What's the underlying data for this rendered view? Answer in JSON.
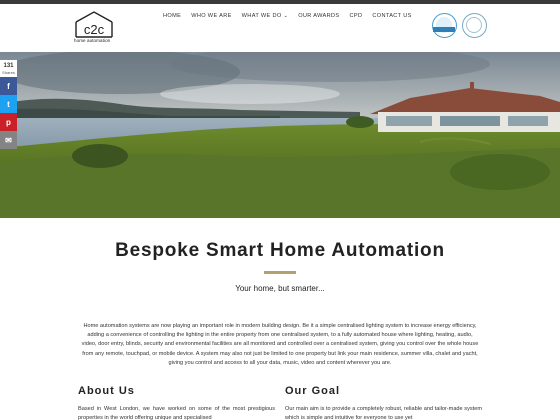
{
  "logo": {
    "mark": "c2c",
    "tagline": "home automation"
  },
  "nav": {
    "items": [
      {
        "label": "HOME"
      },
      {
        "label": "WHO WE ARE"
      },
      {
        "label": "WHAT WE DO",
        "has_dropdown": true
      },
      {
        "label": "OUR AWARDS"
      },
      {
        "label": "CPD"
      },
      {
        "label": "CONTACT US"
      }
    ]
  },
  "badges": [
    {
      "icon": "award-badge-icon"
    },
    {
      "icon": "certification-badge-icon"
    }
  ],
  "share": {
    "count": "131",
    "count_label": "Shares",
    "buttons": [
      {
        "icon": "facebook-icon",
        "glyph": "f",
        "color": "#3b5998"
      },
      {
        "icon": "twitter-icon",
        "glyph": "t",
        "color": "#1da1f2"
      },
      {
        "icon": "pinterest-icon",
        "glyph": "p",
        "color": "#cb2027"
      },
      {
        "icon": "email-icon",
        "glyph": "✉",
        "color": "#848484"
      }
    ]
  },
  "main": {
    "title": "Bespoke Smart Home Automation",
    "tagline": "Your home, but smarter...",
    "intro": "Home automation systems are now playing an important role in modern building design. Be it a simple centralised lighting system to increase energy efficiency, adding a convenience of controlling the lighting in the entire property from one centralised system, to a fully automated house where lighting, heating, audio, video, door entry, blinds, security and environmental facilities are all monitored and controlled over a centralised system, giving you control over the whole house from any remote, touchpad, or mobile device. A system may also not just be limited to one property but link your main residence, summer villa, chalet and yacht, giving you control and access to all your data, music, video and content wherever you are."
  },
  "about": {
    "title": "About Us",
    "text": "Based in West London, we have worked on some of the most prestigious properties in the world offering unique and specialised"
  },
  "goal": {
    "title": "Our Goal",
    "text": "Our main aim is to provide a completely robust, reliable and tailor-made system which is simple and intuitive for everyone to use yet"
  },
  "colors": {
    "accent": "#b3a071",
    "topbar": "#3a3a3a"
  }
}
